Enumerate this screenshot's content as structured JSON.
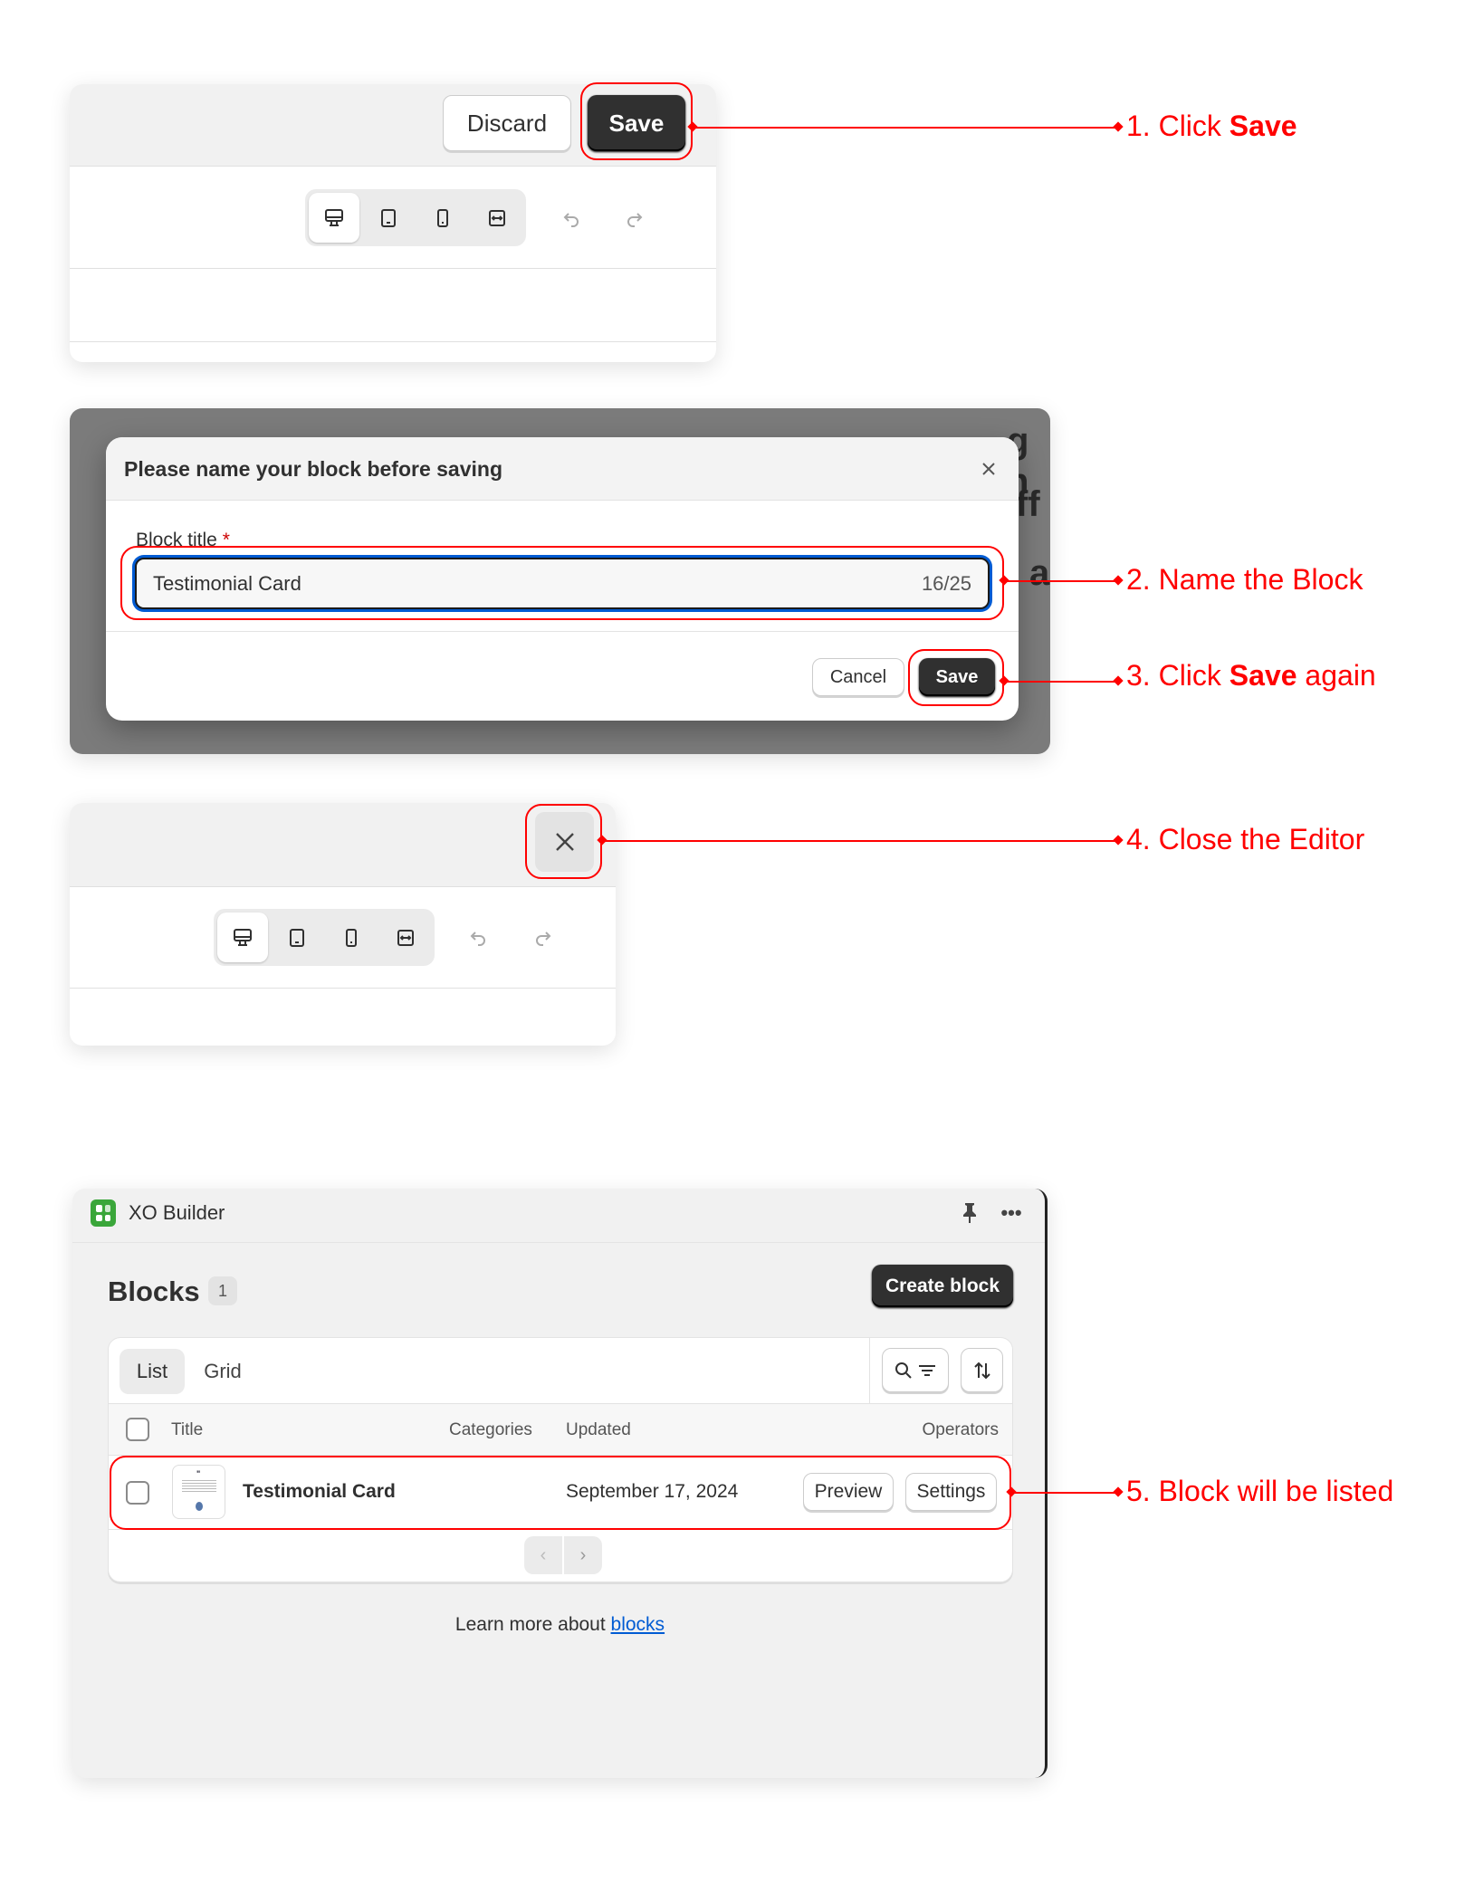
{
  "step1": {
    "discard_label": "Discard",
    "save_label": "Save",
    "toolbar_icons": [
      "desktop-icon",
      "tablet-icon",
      "mobile-icon",
      "full-width-icon"
    ],
    "annotation_prefix": "1. Click ",
    "annotation_bold": "Save"
  },
  "step2": {
    "bg_fragments": [
      "g n",
      "ff",
      "a"
    ],
    "dialog_title": "Please name your block before saving",
    "field_label": "Block title",
    "required_mark": "*",
    "field_value": "Testimonial Card",
    "char_count": "16/25",
    "cancel_label": "Cancel",
    "save_label": "Save",
    "annotation_name": "2. Name the Block",
    "annotation3_prefix": "3. Click ",
    "annotation3_bold": "Save",
    "annotation3_suffix": " again"
  },
  "step4": {
    "annotation": "4. Close the Editor"
  },
  "app": {
    "name": "XO Builder",
    "brand_color": "#3aa63a",
    "page_title": "Blocks",
    "count": "1",
    "create_label": "Create block",
    "tabs": [
      "List",
      "Grid"
    ],
    "columns": [
      "Title",
      "Categories",
      "Updated",
      "Operators"
    ],
    "rows": [
      {
        "title": "Testimonial Card",
        "categories": "",
        "updated": "September 17, 2024",
        "preview": "Preview",
        "settings": "Settings"
      }
    ],
    "learn_more": "Learn more about ",
    "learn_link": "blocks",
    "annotation": "5. Block will be listed"
  },
  "colors": {
    "annotation": "#ff0000",
    "focus": "#005bd3",
    "link": "#005bd3"
  }
}
